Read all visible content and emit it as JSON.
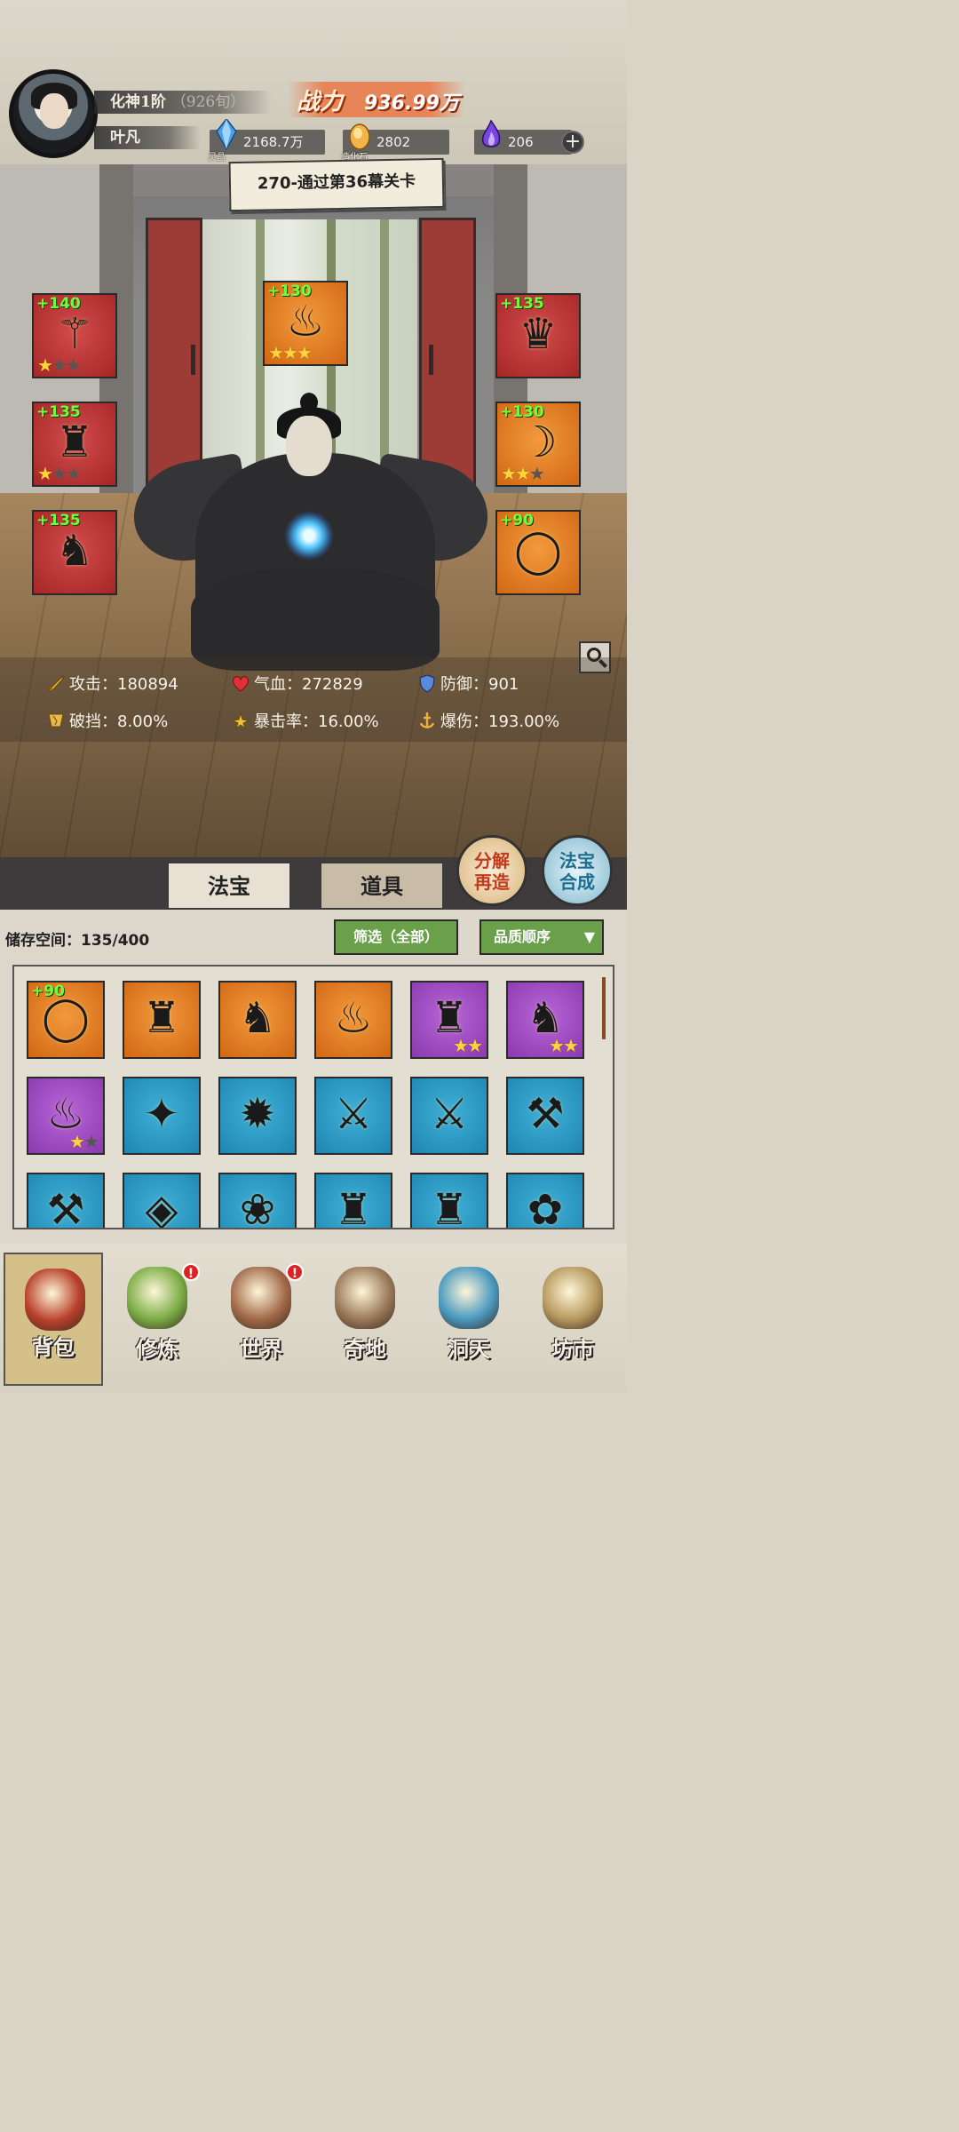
{
  "player": {
    "realm": "化神1阶",
    "realm_sub": "（926旬）",
    "name": "叶凡"
  },
  "power": {
    "label": "战力",
    "value": "936.99万"
  },
  "resources": [
    {
      "icon": "crystal-icon",
      "value": "2168.7万",
      "sub": "灵晶",
      "color": "#3f8fd8"
    },
    {
      "icon": "stone-icon",
      "value": "2802",
      "sub": "造化石",
      "color": "#e8a33c"
    },
    {
      "icon": "soul-flame-icon",
      "value": "206",
      "color": "#6a3ad8"
    }
  ],
  "level_banner": "270-通过第36幕关卡",
  "equipped": [
    {
      "name": "slot-weapon",
      "bonus": "+140",
      "quality": "red",
      "stars": 1,
      "glyph": "⚚"
    },
    {
      "name": "slot-center",
      "bonus": "+130",
      "quality": "orange",
      "stars": 3,
      "glyph": "♨"
    },
    {
      "name": "slot-headband",
      "bonus": "+135",
      "quality": "red",
      "stars": 0,
      "glyph": "♛"
    },
    {
      "name": "slot-robe",
      "bonus": "+135",
      "quality": "red",
      "stars": 1,
      "glyph": "♜"
    },
    {
      "name": "slot-pendant",
      "bonus": "+130",
      "quality": "orange",
      "stars": 2,
      "glyph": "☽"
    },
    {
      "name": "slot-boots",
      "bonus": "+135",
      "quality": "red",
      "stars": 0,
      "glyph": "♞"
    },
    {
      "name": "slot-ring",
      "bonus": "+90",
      "quality": "orange",
      "stars": 0,
      "glyph": "◯"
    }
  ],
  "stats": {
    "attack": "攻击：180894",
    "hp": "气血：272829",
    "defense": "防御：901",
    "break": "破挡：8.00%",
    "crit_rate": "暴击率：16.00%",
    "crit_dmg": "爆伤：193.00%"
  },
  "tabs": {
    "treasure": "法宝",
    "items": "道具"
  },
  "round_buttons": {
    "dismantle_top": "分解",
    "dismantle_bottom": "再造",
    "merge_top": "法宝",
    "merge_bottom": "合成"
  },
  "storage": "储存空间：135/400",
  "filter_label": "筛选（全部）",
  "sort_label": "品质顺序",
  "inventory": [
    {
      "quality": "orange",
      "bonus": "+90",
      "stars": 0,
      "glyph": "◯"
    },
    {
      "quality": "orange",
      "bonus": "",
      "stars": 0,
      "glyph": "♜"
    },
    {
      "quality": "orange",
      "bonus": "",
      "stars": 0,
      "glyph": "♞"
    },
    {
      "quality": "orange",
      "bonus": "",
      "stars": 0,
      "glyph": "♨"
    },
    {
      "quality": "purple",
      "bonus": "",
      "stars": 2,
      "glyph": "♜"
    },
    {
      "quality": "purple",
      "bonus": "",
      "stars": 2,
      "glyph": "♞"
    },
    {
      "quality": "purple",
      "bonus": "",
      "stars": 1,
      "glyph": "♨"
    },
    {
      "quality": "blue",
      "bonus": "",
      "stars": 0,
      "glyph": "✦"
    },
    {
      "quality": "blue",
      "bonus": "",
      "stars": 0,
      "glyph": "✹"
    },
    {
      "quality": "blue",
      "bonus": "",
      "stars": 0,
      "glyph": "⚔"
    },
    {
      "quality": "blue",
      "bonus": "",
      "stars": 0,
      "glyph": "⚔"
    },
    {
      "quality": "blue",
      "bonus": "",
      "stars": 0,
      "glyph": "⚒"
    },
    {
      "quality": "blue",
      "bonus": "",
      "stars": 0,
      "glyph": "⚒"
    },
    {
      "quality": "blue",
      "bonus": "",
      "stars": 0,
      "glyph": "◈"
    },
    {
      "quality": "blue",
      "bonus": "",
      "stars": 0,
      "glyph": "❀"
    },
    {
      "quality": "blue",
      "bonus": "",
      "stars": 0,
      "glyph": "♜"
    },
    {
      "quality": "blue",
      "bonus": "",
      "stars": 0,
      "glyph": "♜"
    },
    {
      "quality": "blue",
      "bonus": "",
      "stars": 0,
      "glyph": "✿"
    }
  ],
  "nav": [
    {
      "label": "背包",
      "icon": "backpack-icon",
      "badge": "",
      "color": "#b8402a"
    },
    {
      "label": "修炼",
      "icon": "lotus-icon",
      "badge": "!",
      "color": "#7cae48"
    },
    {
      "label": "世界",
      "icon": "scroll-icon",
      "badge": "!",
      "color": "#a26a4a"
    },
    {
      "label": "奇地",
      "icon": "mountain-icon",
      "badge": "",
      "color": "#9a7a5a"
    },
    {
      "label": "洞天",
      "icon": "portal-icon",
      "badge": "",
      "color": "#4a9ac0"
    },
    {
      "label": "坊市",
      "icon": "shop-icon",
      "badge": "",
      "color": "#b89a60"
    }
  ]
}
